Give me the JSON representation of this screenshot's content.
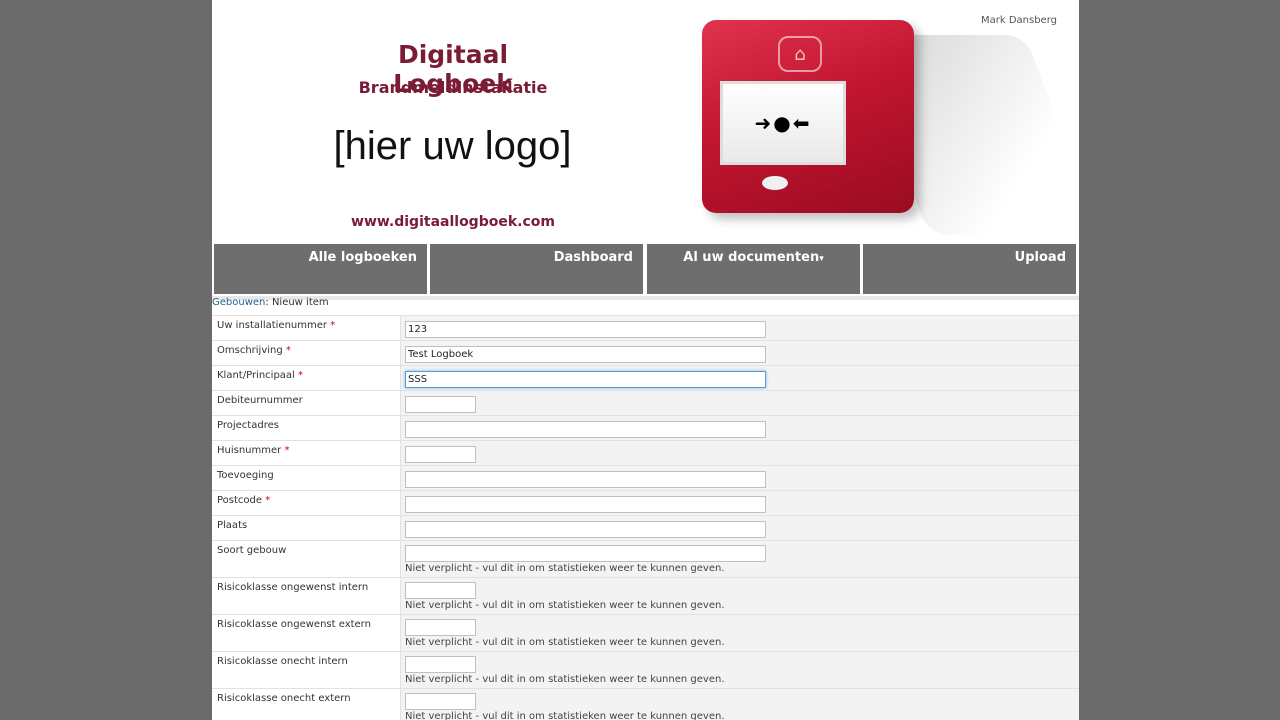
{
  "header": {
    "user_name": "Mark Dansberg",
    "title": "Digitaal Logboek",
    "subtitle": "Brandmeldinstallatie",
    "logo_placeholder": "[hier uw logo]",
    "website": "www.digitaallogboek.com"
  },
  "nav": {
    "items": [
      "Alle logboeken",
      "Dashboard",
      "Al uw documenten",
      "Upload"
    ],
    "dropdown_glyph": "▾"
  },
  "breadcrumb": {
    "parent": "Gebouwen",
    "separator": ":",
    "current": "Nieuw item"
  },
  "required_marker": "*",
  "form": {
    "hint": "Niet verplicht - vul dit in om statistieken weer te kunnen geven.",
    "fields": [
      {
        "label": "Uw installatienummer",
        "required": true,
        "value": "123"
      },
      {
        "label": "Omschrijving",
        "required": true,
        "value": "Test Logboek"
      },
      {
        "label": "Klant/Principaal",
        "required": true,
        "value": "SSS"
      },
      {
        "label": "Debiteurnummer",
        "required": false,
        "value": ""
      },
      {
        "label": "Projectadres",
        "required": false,
        "value": ""
      },
      {
        "label": "Huisnummer",
        "required": true,
        "value": ""
      },
      {
        "label": "Toevoeging",
        "required": false,
        "value": ""
      },
      {
        "label": "Postcode",
        "required": true,
        "value": ""
      },
      {
        "label": "Plaats",
        "required": false,
        "value": ""
      },
      {
        "label": "Soort gebouw",
        "required": false,
        "value": ""
      },
      {
        "label": "Risicoklasse ongewenst intern",
        "required": false,
        "value": ""
      },
      {
        "label": "Risicoklasse ongewenst extern",
        "required": false,
        "value": ""
      },
      {
        "label": "Risicoklasse onecht intern",
        "required": false,
        "value": ""
      },
      {
        "label": "Risicoklasse onecht extern",
        "required": false,
        "value": ""
      }
    ]
  },
  "colors": {
    "brand": "#7b1b36",
    "nav_bg": "#6e6e6e",
    "link": "#21618c",
    "required": "#cc0000",
    "focus": "#5b9bd5"
  }
}
